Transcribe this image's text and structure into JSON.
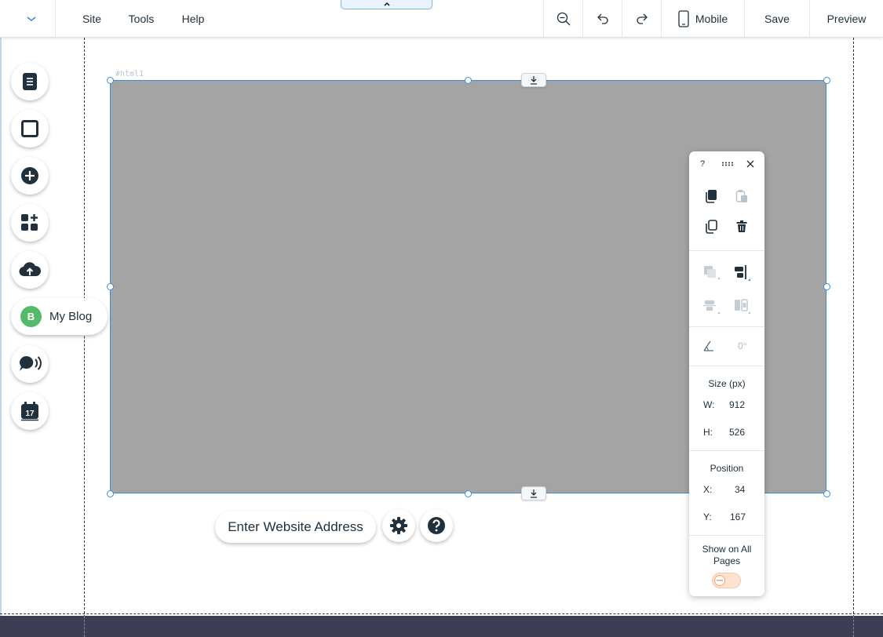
{
  "menu": {
    "site": "Site",
    "tools": "Tools",
    "help": "Help"
  },
  "toolbar": {
    "mobile": "Mobile",
    "save": "Save",
    "preview": "Preview"
  },
  "element": {
    "label": "#html1"
  },
  "sidebar": {
    "blog_badge": "B",
    "blog_label": "My Blog",
    "calendar_day": "17"
  },
  "bottom": {
    "url_label": "Enter Website Address"
  },
  "panel": {
    "help": "?",
    "rotation": "0°",
    "size_title": "Size (px)",
    "w_label": "W:",
    "w_value": "912",
    "h_label": "H:",
    "h_value": "526",
    "position_title": "Position",
    "x_label": "X:",
    "x_value": "34",
    "y_label": "Y:",
    "y_value": "167",
    "show_all_line1": "Show on All",
    "show_all_line2": "Pages"
  },
  "icons": {
    "dropdown": "chevron-down-icon",
    "zoom": "zoom-out-icon",
    "undo": "undo-icon",
    "redo": "redo-icon",
    "mobile": "mobile-phone-icon"
  },
  "colors": {
    "accent": "#3b8dd6",
    "element_fill": "#a4a4a4",
    "footer": "#3d3d55",
    "blog": "#55b96a",
    "toggle_off": "#f5a06b"
  }
}
